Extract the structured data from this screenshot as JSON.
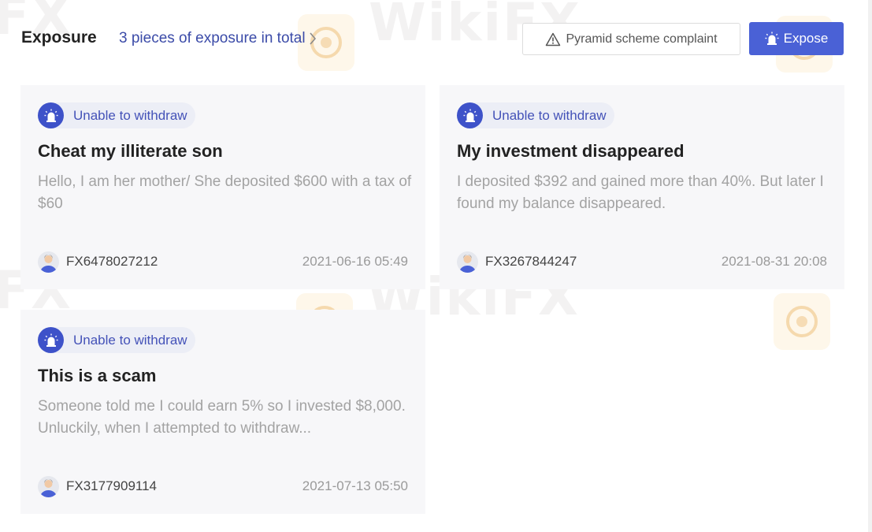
{
  "header": {
    "title": "Exposure",
    "total_link": "3 pieces of exposure in total",
    "complaint_button": "Pyramid scheme complaint",
    "expose_button": "Expose"
  },
  "watermark": {
    "text": "WikiFX",
    "text_short": "FX"
  },
  "cards": [
    {
      "tag": "Unable to withdraw",
      "title": "Cheat my illiterate son",
      "description": "Hello, I am her mother/ She deposited $600 with a tax of $60",
      "user": "FX6478027212",
      "date": "2021-06-16 05:49"
    },
    {
      "tag": "Unable to withdraw",
      "title": "My investment disappeared",
      "description": "I deposited $392 and gained more than 40%. But later I found my balance disappeared.",
      "user": "FX3267844247",
      "date": "2021-08-31 20:08"
    },
    {
      "tag": "Unable to withdraw",
      "title": "This is a scam",
      "description": "Someone told me I could earn 5% so I invested $8,000. Unluckily, when I attempted to withdraw...",
      "user": "FX3177909114",
      "date": "2021-07-13 05:50"
    }
  ],
  "colors": {
    "accent": "#4a61d6",
    "tag_icon_bg": "#3e52c9",
    "link": "#3b4ba8",
    "card_bg": "#f7f7f9"
  },
  "icons": {
    "chevron": "chevron-right-icon",
    "warning": "warning-triangle-icon",
    "alarm": "alarm-siren-icon",
    "avatar": "user-avatar-icon"
  }
}
